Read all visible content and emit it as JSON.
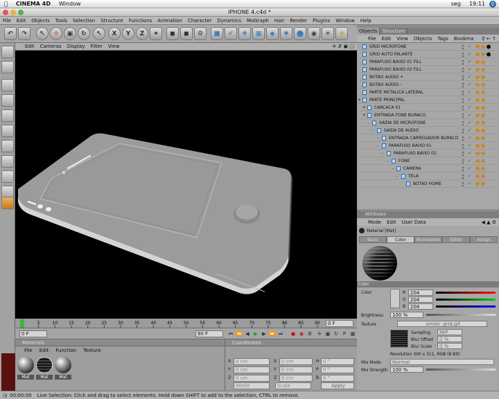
{
  "mac_menu": {
    "app": "CINEMA 4D",
    "window": "Window",
    "day": "seg",
    "time": "19:11"
  },
  "window_title": "IPHONE 4.c4d *",
  "menu": [
    "File",
    "Edit",
    "Objects",
    "Tools",
    "Selection",
    "Structure",
    "Functions",
    "Animation",
    "Character",
    "Dynamics",
    "MoGraph",
    "Hair",
    "Render",
    "Plugins",
    "Window",
    "Help"
  ],
  "toolbar": {
    "x": "X",
    "y": "Y",
    "z": "Z"
  },
  "viewport_menu": [
    "Edit",
    "Cameras",
    "Display",
    "Filter",
    "View"
  ],
  "timeline": {
    "ticks": [
      "0",
      "5",
      "10",
      "15",
      "20",
      "25",
      "30",
      "35",
      "40",
      "45",
      "50",
      "55",
      "60",
      "65",
      "70",
      "75",
      "80",
      "85",
      "90"
    ],
    "current_frame": "0 F",
    "end_frame": "90 F",
    "start": "0 F",
    "fps_field": "0 F"
  },
  "materials": {
    "header": "Materials",
    "menu": [
      "File",
      "Edit",
      "Function",
      "Texture"
    ],
    "items": [
      "Mat",
      "Mat",
      "Mat"
    ]
  },
  "coordinates": {
    "header": "Coordinates",
    "row_labels": [
      "X",
      "Y",
      "Z"
    ],
    "mid_labels": [
      "X",
      "Y",
      "Z"
    ],
    "right_labels": [
      "H",
      "P",
      "B"
    ],
    "value": "0 cm",
    "angle": "0 °",
    "mode1": "World",
    "mode2": "Scale",
    "apply": "Apply"
  },
  "status": {
    "time": "00:00:00",
    "text": "Live Selection: Click and drag to select elements. Hold down SHIFT to add to the selection, CTRL to remove."
  },
  "object_manager": {
    "tabs": [
      "Objects",
      "Structure"
    ],
    "menu": [
      "File",
      "Edit",
      "View",
      "Objects",
      "Tags",
      "Bookma"
    ],
    "rows": [
      {
        "name": "GRID MICROFONE",
        "indent": 0
      },
      {
        "name": "GRID AUTO FALANTE",
        "indent": 0
      },
      {
        "name": "PARAFUSO BAIXO 01 FILL",
        "indent": 0
      },
      {
        "name": "PARAFUSO BAIXO 02  FILL",
        "indent": 0
      },
      {
        "name": "BOTAO AUDIO +",
        "indent": 0
      },
      {
        "name": "BOTAO AUDIO -",
        "indent": 0
      },
      {
        "name": "PARTE METALICA LATERAL",
        "indent": 0
      },
      {
        "name": "PARTE PRINCIPAL",
        "indent": 0
      },
      {
        "name": "CARCACA 01",
        "indent": 1
      },
      {
        "name": "ENTRADA FONE BURACO",
        "indent": 1
      },
      {
        "name": "SAIDA DE MICROFONE",
        "indent": 2
      },
      {
        "name": "SAIDA DE AUDIO",
        "indent": 3
      },
      {
        "name": "ENTRADA CARREGADOR BURACO",
        "indent": 4
      },
      {
        "name": "PARAFUSO BAIXO 01",
        "indent": 4
      },
      {
        "name": "PARAFUSO BAIXO 02",
        "indent": 5
      },
      {
        "name": "FONE",
        "indent": 6
      },
      {
        "name": "CAMERA",
        "indent": 7
      },
      {
        "name": "TELA",
        "indent": 8
      },
      {
        "name": "BOTAO HOME",
        "indent": 9
      }
    ]
  },
  "attributes": {
    "header": "Attributes",
    "menu": [
      "Mode",
      "Edit",
      "User Data"
    ],
    "object": "Material [Mat]",
    "tabs": [
      "Basic",
      "Color",
      "Illumination",
      "Editor",
      "Assign"
    ],
    "section": "Color",
    "color_label": "Color",
    "r_label": "R",
    "g_label": "G",
    "b_label": "B",
    "r": "204",
    "g": "204",
    "b": "204",
    "brightness_label": "Brightness",
    "brightness": "100 %",
    "texture_label": "Texture",
    "texture_file": "smiler_grid.gif",
    "sampling_label": "Sampling",
    "sampling": "MIP",
    "blur_offset_label": "Blur Offset",
    "blur_offset": "0 %",
    "blur_scale_label": "Blur Scale",
    "blur_scale": "0 %",
    "resolution": "Resolution 300 x 311, RGB (8 Bit)",
    "mix_mode_label": "Mix Mode",
    "mix_mode": "Normal",
    "mix_strength_label": "Mix Strength",
    "mix_strength": "100 %"
  },
  "colors": {
    "viewport_bg": "#000000",
    "phone": "#9a9a9a",
    "accent_blue": "#2c6aa8"
  }
}
